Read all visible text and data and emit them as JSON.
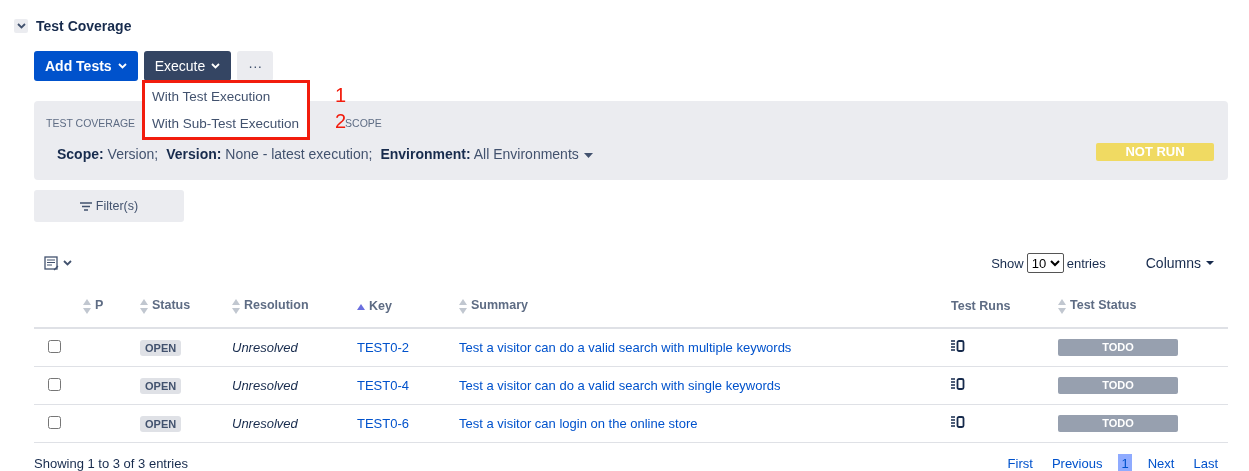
{
  "section": {
    "title": "Test Coverage",
    "expanded": true
  },
  "toolbar": {
    "add_button": "Add Tests",
    "execute_button": "Execute",
    "more_button": "···"
  },
  "execute_menu": {
    "items": [
      {
        "label": "With Test Execution",
        "annotation": "1"
      },
      {
        "label": "With Sub-Test Execution",
        "annotation": "2"
      }
    ]
  },
  "coverage_panel": {
    "heading_left": "TEST COVERAGE",
    "heading_right": "SCOPE",
    "scope_parts": [
      "**Scope:** Version;",
      "**Version:** None - latest execution;",
      "**Environment:** All Environments"
    ],
    "overall_status": "NOT RUN"
  },
  "filter_button": "Filter(s)",
  "length_control": {
    "show": "Show",
    "value": "10",
    "entries": "entries"
  },
  "columns_button": "Columns",
  "table": {
    "columns": [
      {
        "label": "P",
        "sortable": true,
        "sorted": false
      },
      {
        "label": "Status",
        "sortable": true,
        "sorted": false
      },
      {
        "label": "Resolution",
        "sortable": true,
        "sorted": false
      },
      {
        "label": "Key",
        "sortable": true,
        "sorted": true
      },
      {
        "label": "Summary",
        "sortable": true,
        "sorted": false
      },
      {
        "label": "Test Runs",
        "sortable": false,
        "sorted": false
      },
      {
        "label": "Test Status",
        "sortable": true,
        "sorted": false
      }
    ],
    "rows": [
      {
        "checked": false,
        "status": "OPEN",
        "resolution": "Unresolved",
        "key": "TEST0-2",
        "summary": "Test a visitor can do a valid search with multiple keywords",
        "test_status": "TODO"
      },
      {
        "checked": false,
        "status": "OPEN",
        "resolution": "Unresolved",
        "key": "TEST0-4",
        "summary": "Test a visitor can do a valid search with single keywords",
        "test_status": "TODO"
      },
      {
        "checked": false,
        "status": "OPEN",
        "resolution": "Unresolved",
        "key": "TEST0-6",
        "summary": "Test a visitor can login on the online store",
        "test_status": "TODO"
      }
    ]
  },
  "footer": {
    "info": "Showing 1 to 3 of 3 entries",
    "pages": [
      {
        "label": "First",
        "selected": false
      },
      {
        "label": "Previous",
        "selected": false
      },
      {
        "label": "1",
        "selected": true
      },
      {
        "label": "Next",
        "selected": false
      },
      {
        "label": "Last",
        "selected": false
      }
    ]
  }
}
